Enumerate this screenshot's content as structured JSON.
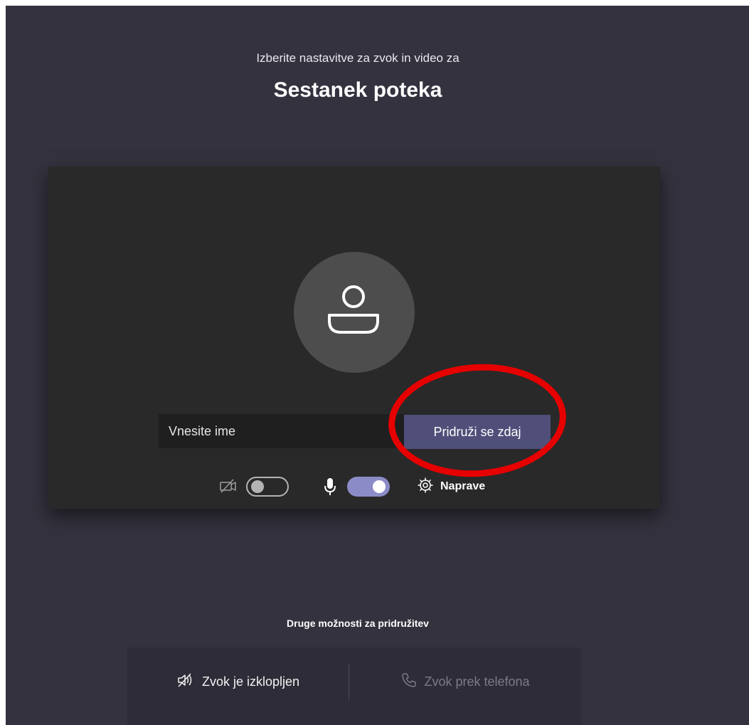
{
  "header": {
    "subtitle": "Izberite nastavitve za zvok in video za",
    "meeting_title": "Sestanek poteka"
  },
  "preview": {
    "name_input": {
      "placeholder": "Vnesite ime",
      "value": ""
    },
    "join_button_label": "Pridruži se zdaj",
    "camera_toggle": {
      "state": "off",
      "icon": "camera-off-icon"
    },
    "mic_toggle": {
      "state": "on",
      "icon": "microphone-icon"
    },
    "devices": {
      "icon": "gear-icon",
      "label": "Naprave"
    }
  },
  "other_options": {
    "heading": "Druge možnosti za pridružitev",
    "audio_off": {
      "icon": "speaker-off-icon",
      "label": "Zvok je izklopljen"
    },
    "phone_audio": {
      "icon": "phone-icon",
      "label": "Zvok prek telefona"
    }
  },
  "colors": {
    "background": "#33323e",
    "preview_panel": "#292929",
    "avatar": "#4d4d4d",
    "join_button": "#4f4f7a",
    "toggle_on": "#8b8cc7",
    "highlight_ring": "#e60000"
  }
}
